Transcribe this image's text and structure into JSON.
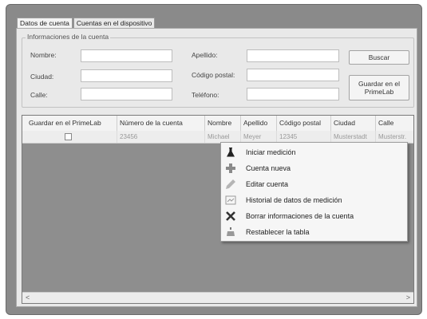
{
  "tabs": [
    {
      "label": "Datos de cuenta",
      "active": true
    },
    {
      "label": "Cuentas en el dispositivo",
      "active": false
    }
  ],
  "account_info": {
    "legend": "Informaciones de la cuenta",
    "fields": {
      "nombre": {
        "label": "Nombre:",
        "value": ""
      },
      "apellido": {
        "label": "Apellido:",
        "value": ""
      },
      "ciudad": {
        "label": "Ciudad:",
        "value": ""
      },
      "codigo_postal": {
        "label": "Código postal:",
        "value": ""
      },
      "calle": {
        "label": "Calle:",
        "value": ""
      },
      "telefono": {
        "label": "Teléfono:",
        "value": ""
      }
    },
    "buttons": {
      "search": "Buscar",
      "save": "Guardar en el PrimeLab"
    }
  },
  "table": {
    "columns": [
      "Guardar en el PrimeLab",
      "Número de la cuenta",
      "Nombre",
      "Apellido",
      "Código postal",
      "Ciudad",
      "Calle"
    ],
    "rows": [
      {
        "saved": false,
        "cells": [
          "",
          "23456",
          "Michael",
          "Meyer",
          "12345",
          "Musterstadt",
          "Musterstr."
        ]
      }
    ]
  },
  "context_menu": {
    "items": [
      {
        "label": "Iniciar medición",
        "icon": "flask-icon"
      },
      {
        "label": "Cuenta nueva",
        "icon": "plus-icon"
      },
      {
        "label": "Editar cuenta",
        "icon": "pencil-icon"
      },
      {
        "label": "Historial de datos de medición",
        "icon": "history-icon"
      },
      {
        "label": "Borrar informaciones de la cuenta",
        "icon": "delete-x-icon"
      },
      {
        "label": "Restablecer la tabla",
        "icon": "reset-icon"
      }
    ]
  },
  "scrollbar": {
    "left_arrow": "<",
    "right_arrow": ">"
  }
}
